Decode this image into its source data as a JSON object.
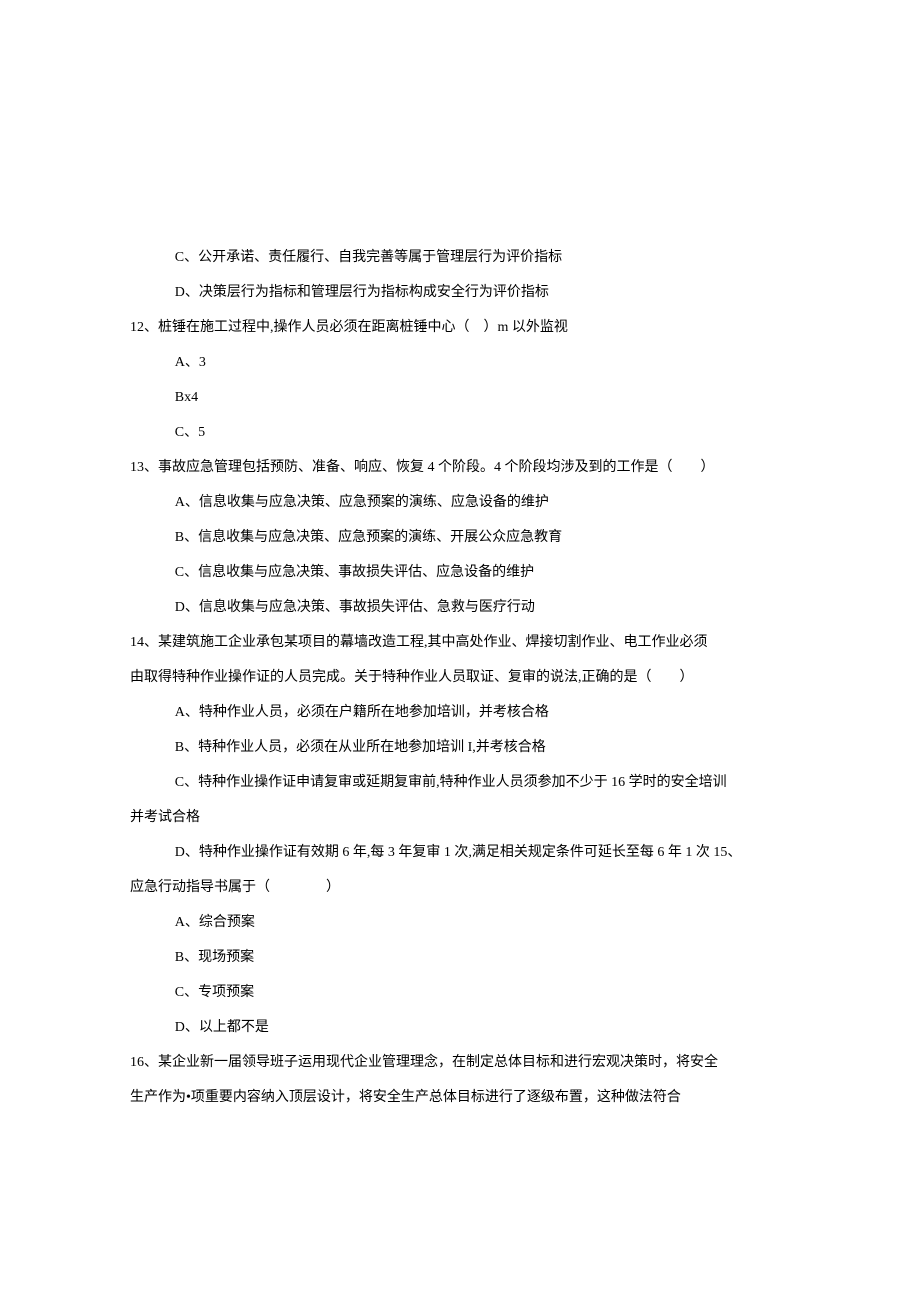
{
  "lines": [
    {
      "cls": "indent-option",
      "text": "C、公开承诺、责任履行、自我完善等属于管理层行为评价指标"
    },
    {
      "cls": "indent-option",
      "text": "D、决策层行为指标和管理层行为指标构成安全行为评价指标"
    },
    {
      "cls": "question",
      "text": "12、桩锤在施工过程中,操作人员必须在距离桩锤中心（　）m 以外监视"
    },
    {
      "cls": "indent-option",
      "text": "A、3"
    },
    {
      "cls": "indent-option",
      "text": "Bx4"
    },
    {
      "cls": "indent-option",
      "text": "C、5"
    },
    {
      "cls": "question",
      "text": "13、事故应急管理包括预防、准备、响应、恢复 4 个阶段。4 个阶段均涉及到的工作是（　　）"
    },
    {
      "cls": "indent-option",
      "text": "A、信息收集与应急决策、应急预案的演练、应急设备的维护"
    },
    {
      "cls": "indent-option",
      "text": "B、信息收集与应急决策、应急预案的演练、开展公众应急教育"
    },
    {
      "cls": "indent-option",
      "text": "C、信息收集与应急决策、事故损失评估、应急设备的维护"
    },
    {
      "cls": "indent-option",
      "text": "D、信息收集与应急决策、事故损失评估、急救与医疗行动"
    },
    {
      "cls": "question",
      "text": "14、某建筑施工企业承包某项目的幕墙改造工程,其中高处作业、焊接切割作业、电工作业必须"
    },
    {
      "cls": "continuation",
      "text": "由取得特种作业操作证的人员完成。关于特种作业人员取证、复审的说法,正确的是（　　）"
    },
    {
      "cls": "indent-option",
      "text": "A、特种作业人员，必须在户籍所在地参加培训，并考核合格"
    },
    {
      "cls": "indent-option",
      "text": "B、特种作业人员，必须在从业所在地参加培训 I,并考核合格"
    },
    {
      "cls": "indent-option",
      "text": "C、特种作业操作证申请复审或延期复审前,特种作业人员须参加不少于 16 学时的安全培训"
    },
    {
      "cls": "continuation",
      "text": "并考试合格"
    },
    {
      "cls": "indent-option",
      "text": "D、特种作业操作证有效期 6 年,每 3 年复审 1 次,满足相关规定条件可延长至每 6 年 1 次 15、"
    },
    {
      "cls": "continuation",
      "text": "应急行动指导书属于（　　　　）"
    },
    {
      "cls": "indent-option",
      "text": "A、综合预案"
    },
    {
      "cls": "indent-option",
      "text": "B、现场预案"
    },
    {
      "cls": "indent-option",
      "text": "C、专项预案"
    },
    {
      "cls": "indent-option",
      "text": "D、以上都不是"
    },
    {
      "cls": "question",
      "text": "16、某企业新一届领导班子运用现代企业管理理念，在制定总体目标和进行宏观决策时，将安全"
    },
    {
      "cls": "continuation",
      "text": "生产作为•项重要内容纳入顶层设计，将安全生产总体目标进行了逐级布置，这种做法符合"
    }
  ]
}
